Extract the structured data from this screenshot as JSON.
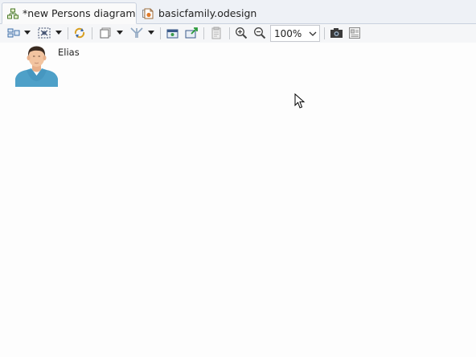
{
  "tabs": [
    {
      "label": "*new Persons diagram",
      "active": true,
      "icon": "diagram-icon"
    },
    {
      "label": "basicfamily.odesign",
      "active": false,
      "icon": "odesign-file-icon"
    }
  ],
  "toolbar": {
    "zoom_value": "100%",
    "buttons": [
      "arrange-all-icon",
      "select-all-icon",
      "refresh-icon",
      "layers-icon",
      "filters-icon",
      "export-image-icon",
      "pin-icon",
      "paste-format-icon",
      "zoom-in-icon",
      "zoom-out-icon",
      "camera-icon",
      "properties-icon"
    ]
  },
  "diagram": {
    "nodes": [
      {
        "label": "Elias",
        "icon": "person-male-icon"
      }
    ]
  },
  "colors": {
    "tab_bar": "#eef1f6",
    "canvas": "#fdfdfd",
    "person_shirt": "#4ea0c8"
  }
}
